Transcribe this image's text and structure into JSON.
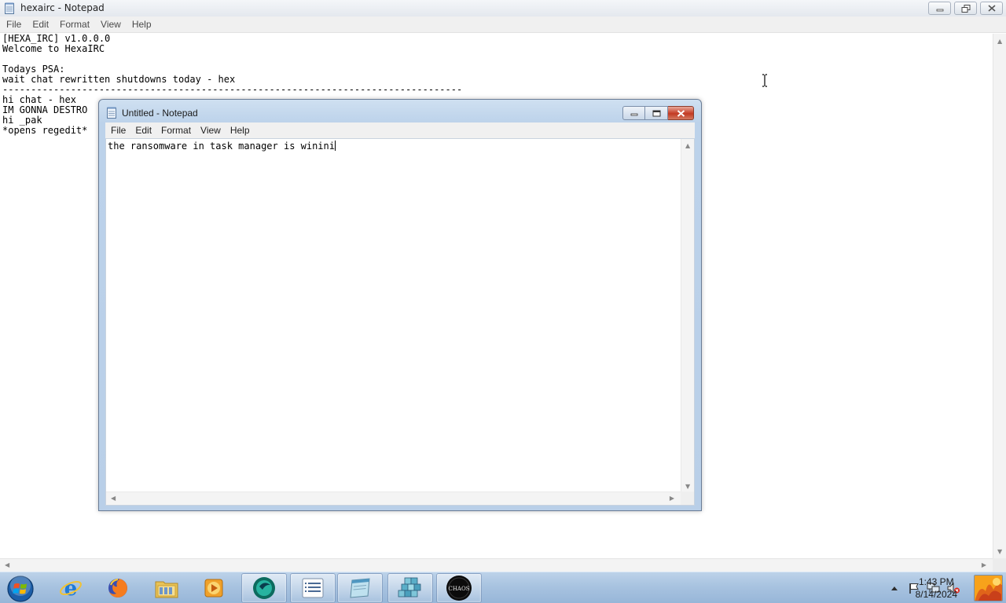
{
  "main_window": {
    "title": "hexairc - Notepad",
    "menu": [
      "File",
      "Edit",
      "Format",
      "View",
      "Help"
    ],
    "lines": [
      "[HEXA_IRC] v1.0.0.0",
      "Welcome to HexaIRC",
      "",
      "Todays PSA:",
      "wait chat rewritten shutdowns today - hex",
      "---------------------------------------------------------------------------------",
      "hi chat - hex",
      "IM GONNA DESTRO",
      "hi _pak",
      "*opens regedit*"
    ]
  },
  "sub_window": {
    "title": "Untitled - Notepad",
    "menu": [
      "File",
      "Edit",
      "Format",
      "View",
      "Help"
    ],
    "text": "the ransomware in task manager is winini"
  },
  "taskbar": {
    "items": [
      "start-orb",
      "internet-explorer",
      "firefox",
      "file-explorer",
      "media-player",
      "hexa-app",
      "notepad-list",
      "paint",
      "registry-editor",
      "chaos"
    ],
    "chaos_label": "CHAOS",
    "clock_time": "1:43 PM",
    "clock_date": "8/14/2024"
  }
}
